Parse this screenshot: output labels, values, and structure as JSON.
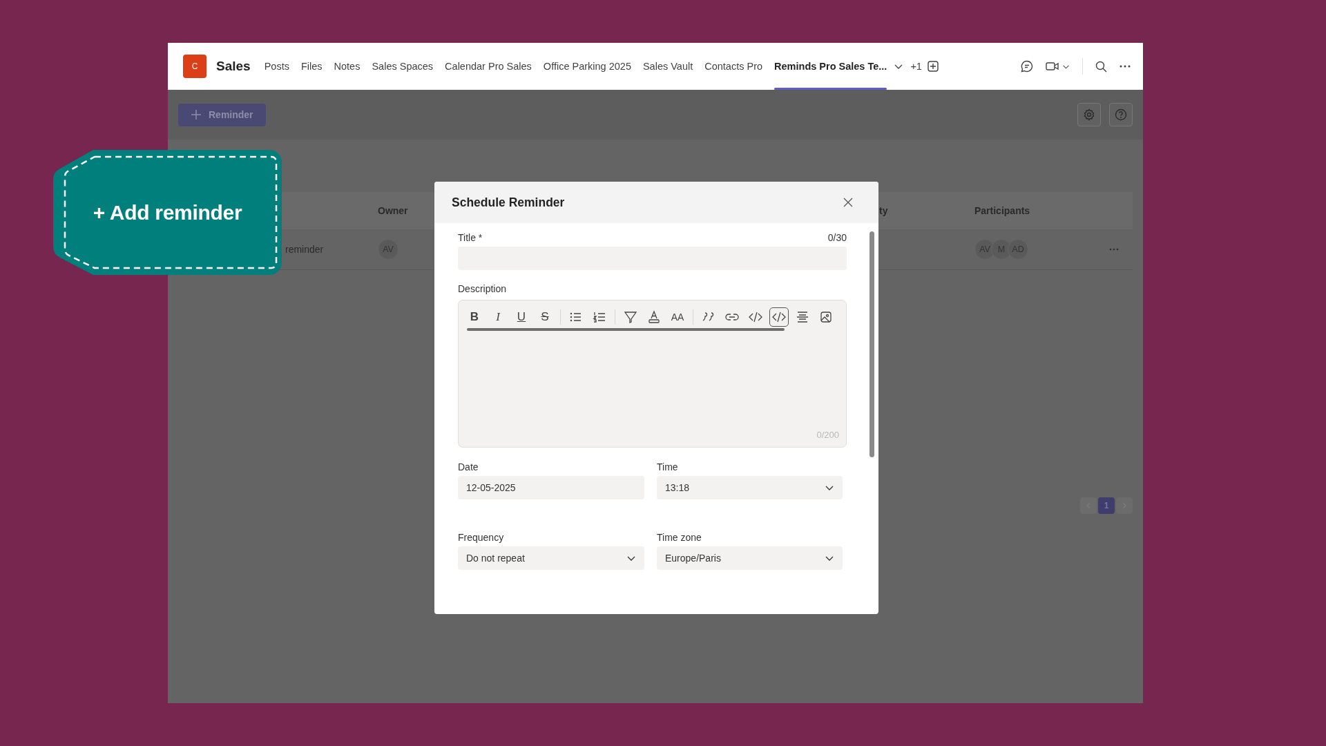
{
  "top_bar": {
    "logo": "C",
    "team": "Sales",
    "tabs": [
      {
        "label": "Posts",
        "selected": false
      },
      {
        "label": "Files",
        "selected": false
      },
      {
        "label": "Notes",
        "selected": false
      },
      {
        "label": "Sales Spaces",
        "selected": false
      },
      {
        "label": "Calendar Pro Sales",
        "selected": false
      },
      {
        "label": "Office Parking 2025",
        "selected": false
      },
      {
        "label": "Sales Vault",
        "selected": false
      },
      {
        "label": "Contacts Pro",
        "selected": false
      },
      {
        "label": "Reminds Pro Sales Te...",
        "selected": true
      }
    ],
    "overflow": "+1"
  },
  "page": {
    "add_button": "Reminder",
    "table": {
      "columns": [
        "Owner",
        "ty",
        "Participants"
      ],
      "rows": [
        {
          "title": "reminder",
          "owner": "AV",
          "participants": [
            "AV",
            "M",
            "AD"
          ]
        }
      ]
    },
    "pagination": [
      {
        "label": "1",
        "selected": true
      }
    ]
  },
  "callout": {
    "text": "+ Add reminder"
  },
  "dialog": {
    "title": "Schedule Reminder",
    "title_field": {
      "label": "Title *",
      "counter": "0/30"
    },
    "description": {
      "label": "Description",
      "counter": "0/200",
      "toolbar": [
        [
          {
            "kind": "bold",
            "text": "B",
            "selected": false
          },
          {
            "kind": "italic",
            "text": "I",
            "selected": false
          },
          {
            "kind": "underline",
            "text": "U",
            "selected": false
          },
          {
            "kind": "strike",
            "text": "S",
            "selected": false
          }
        ],
        [
          {
            "kind": "bullets",
            "selected": false
          },
          {
            "kind": "numbers",
            "selected": false
          }
        ],
        [
          {
            "kind": "highlight",
            "selected": false
          },
          {
            "kind": "fontcolor",
            "selected": false
          },
          {
            "kind": "fontsize",
            "text": "AA",
            "selected": false
          }
        ],
        [
          {
            "kind": "quote",
            "selected": false
          },
          {
            "kind": "link",
            "selected": false
          },
          {
            "kind": "code",
            "selected": false
          },
          {
            "kind": "codeblock",
            "selected": true
          },
          {
            "kind": "align",
            "selected": false
          },
          {
            "kind": "image",
            "selected": false
          }
        ]
      ]
    },
    "date": {
      "label": "Date",
      "value": "12-05-2025"
    },
    "time": {
      "label": "Time",
      "value": "13:18"
    },
    "frequency": {
      "label": "Frequency",
      "value": "Do not repeat"
    },
    "time_zone": {
      "label": "Time zone",
      "value": "Europe/Paris"
    }
  }
}
